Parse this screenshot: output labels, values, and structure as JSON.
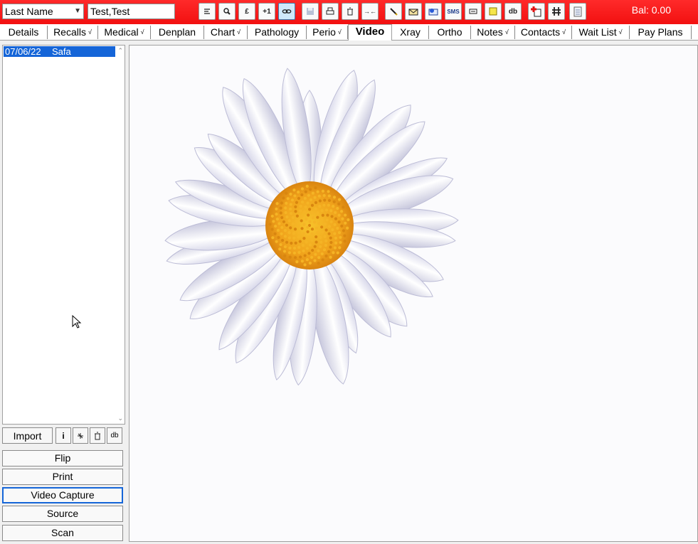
{
  "toolbar": {
    "search_mode": "Last Name",
    "patient_name": "Test,Test",
    "balance": "Bal: 0.00",
    "icons": [
      "list-icon",
      "search-icon",
      "pound-icon",
      "plus-one-icon",
      "link-icon",
      "save-icon",
      "print-icon",
      "delete-icon",
      "merge-icon",
      "pen-icon",
      "letter-icon",
      "email-icon",
      "sms-icon",
      "card-icon",
      "note-icon",
      "database-icon",
      "medical-alert-icon",
      "grid-icon",
      "clipboard-icon"
    ],
    "sms_label": "SMS",
    "plus_one_label": "+1",
    "db_label": "db"
  },
  "tabs": [
    {
      "label": "Details"
    },
    {
      "label": "Recalls",
      "tick": "√"
    },
    {
      "label": "Medical",
      "tick": "√"
    },
    {
      "label": "Denplan"
    },
    {
      "label": "Chart",
      "tick": "√"
    },
    {
      "label": "Pathology"
    },
    {
      "label": "Perio",
      "tick": "√"
    },
    {
      "label": "Video"
    },
    {
      "label": "Xray"
    },
    {
      "label": "Ortho"
    },
    {
      "label": "Notes",
      "tick": "√"
    },
    {
      "label": "Contacts",
      "tick": "√"
    },
    {
      "label": "Wait List",
      "tick": "√"
    },
    {
      "label": "Pay Plans"
    }
  ],
  "active_tab": "Video",
  "video_list": [
    {
      "date": "07/06/22",
      "name": "Safa"
    }
  ],
  "list_actions": {
    "import": "Import",
    "info": "i",
    "db": "db"
  },
  "buttons": {
    "flip": "Flip",
    "print": "Print",
    "video_capture": "Video Capture",
    "source": "Source",
    "scan": "Scan"
  },
  "colors": {
    "toolbar_red": "#f21010",
    "selection_blue": "#1565d8",
    "daisy_center": "#f0a21b"
  }
}
